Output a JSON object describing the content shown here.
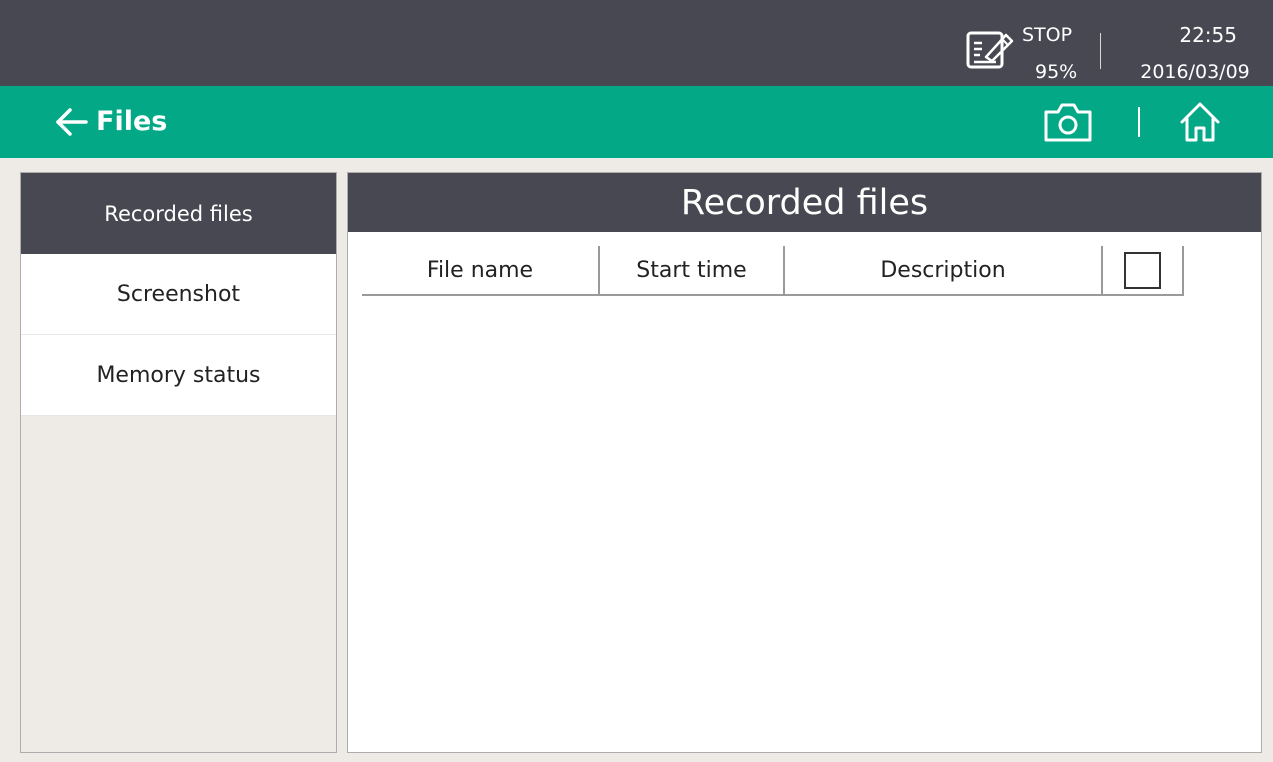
{
  "status_bar": {
    "record_icon": "record-note-icon",
    "record_state": "STOP",
    "record_percent": "95%",
    "time": "22:55",
    "date": "2016/03/09"
  },
  "title_bar": {
    "title": "Files",
    "back_icon": "back-arrow-icon",
    "camera_icon": "camera-icon",
    "home_icon": "home-icon",
    "background_color": "#03a887"
  },
  "sidebar": {
    "items": [
      {
        "label": "Recorded files",
        "active": true
      },
      {
        "label": "Screenshot",
        "active": false
      },
      {
        "label": "Memory status",
        "active": false
      }
    ]
  },
  "panel": {
    "title": "Recorded files",
    "columns": [
      "File name",
      "Start time",
      "Description"
    ],
    "select_all_checked": false,
    "rows": []
  },
  "colors": {
    "dark_header": "#474852",
    "accent_green": "#03a887",
    "background": "#eeebe6"
  }
}
